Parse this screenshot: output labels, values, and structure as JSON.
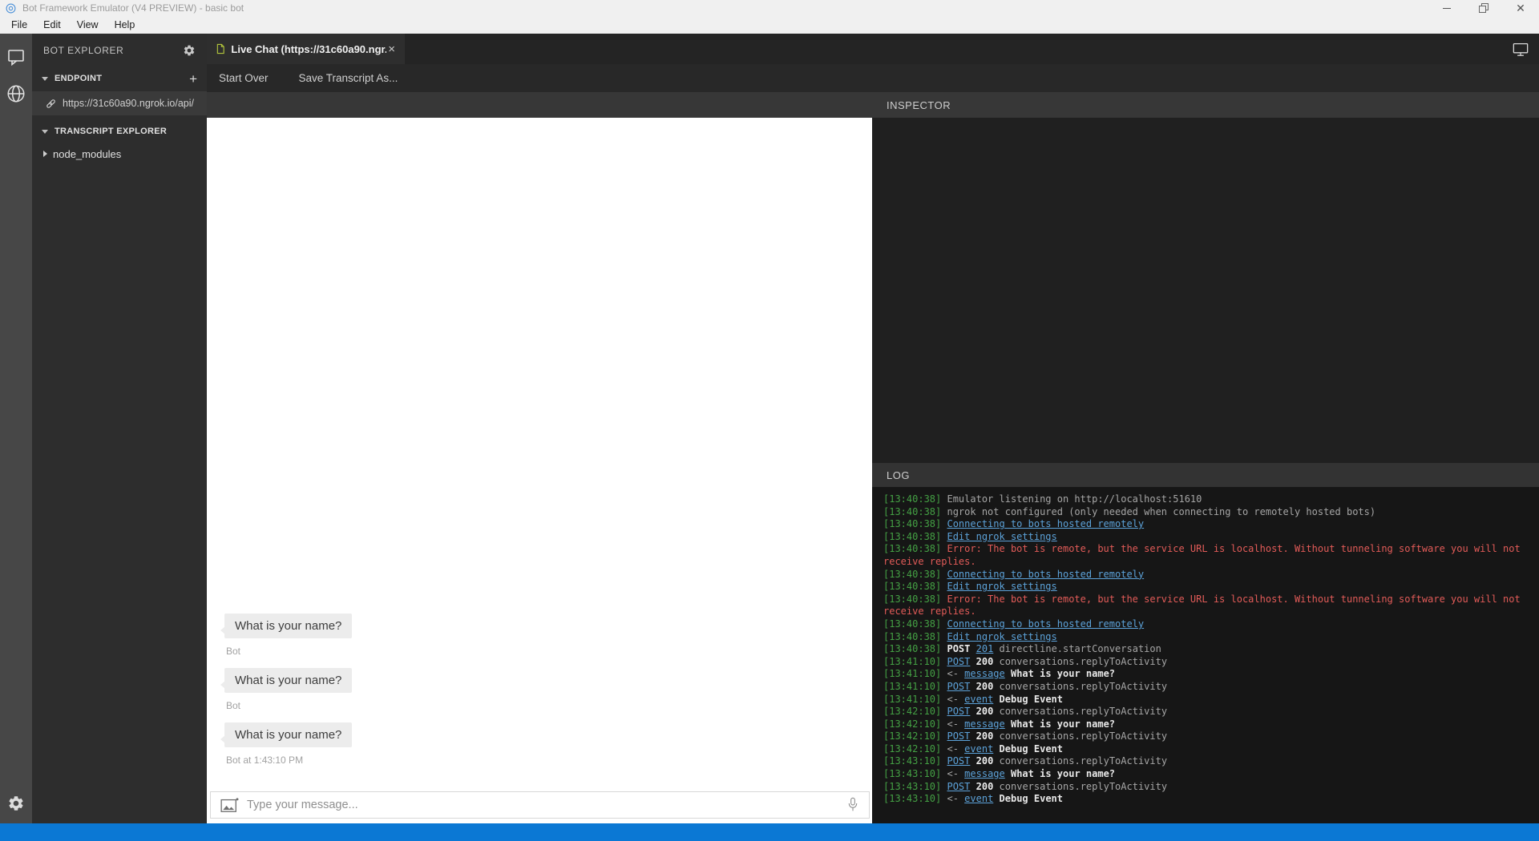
{
  "window": {
    "title": "Bot Framework Emulator (V4 PREVIEW) - basic bot"
  },
  "menu": {
    "items": [
      "File",
      "Edit",
      "View",
      "Help"
    ]
  },
  "rail": {
    "icons": [
      "chat-icon",
      "globe-icon",
      "settings-icon"
    ]
  },
  "explorer": {
    "title": "BOT EXPLORER",
    "endpoint_section": "ENDPOINT",
    "add_button": "+",
    "endpoint_url": "https://31c60a90.ngrok.io/api/",
    "transcript_section": "TRANSCRIPT EXPLORER",
    "transcript_items": [
      "node_modules"
    ]
  },
  "tab": {
    "label": "Live Chat (https://31c60a90.ngr...",
    "close": "×"
  },
  "toolbar": {
    "buttons": [
      "Start Over",
      "Save Transcript As..."
    ]
  },
  "chat": {
    "messages": [
      {
        "text": "What is your name?",
        "meta": "Bot"
      },
      {
        "text": "What is your name?",
        "meta": "Bot"
      },
      {
        "text": "What is your name?",
        "meta": "Bot at 1:43:10 PM"
      }
    ],
    "input_placeholder": "Type your message..."
  },
  "inspector": {
    "title": "INSPECTOR"
  },
  "log": {
    "title": "LOG",
    "entries": [
      {
        "ts": "13:40:38",
        "segments": [
          {
            "k": "text",
            "v": "Emulator listening on http://localhost:51610"
          }
        ]
      },
      {
        "ts": "13:40:38",
        "segments": [
          {
            "k": "text",
            "v": "ngrok not configured (only needed when connecting to remotely hosted bots)"
          }
        ]
      },
      {
        "ts": "13:40:38",
        "segments": [
          {
            "k": "link",
            "v": "Connecting to bots hosted remotely"
          }
        ]
      },
      {
        "ts": "13:40:38",
        "segments": [
          {
            "k": "link",
            "v": "Edit ngrok settings"
          }
        ]
      },
      {
        "ts": "13:40:38",
        "segments": [
          {
            "k": "error",
            "v": "Error: The bot is remote, but the service URL is localhost. Without tunneling software you will not receive replies."
          }
        ]
      },
      {
        "ts": "13:40:38",
        "segments": [
          {
            "k": "link",
            "v": "Connecting to bots hosted remotely"
          }
        ]
      },
      {
        "ts": "13:40:38",
        "segments": [
          {
            "k": "link",
            "v": "Edit ngrok settings"
          }
        ]
      },
      {
        "ts": "13:40:38",
        "segments": [
          {
            "k": "error",
            "v": "Error: The bot is remote, but the service URL is localhost. Without tunneling software you will not receive replies."
          }
        ]
      },
      {
        "ts": "13:40:38",
        "segments": [
          {
            "k": "link",
            "v": "Connecting to bots hosted remotely"
          }
        ]
      },
      {
        "ts": "13:40:38",
        "segments": [
          {
            "k": "link",
            "v": "Edit ngrok settings"
          }
        ]
      },
      {
        "ts": "13:40:38",
        "segments": [
          {
            "k": "bold",
            "v": "POST"
          },
          {
            "k": "link",
            "v": "201"
          },
          {
            "k": "text",
            "v": "directline.startConversation"
          }
        ]
      },
      {
        "ts": "13:41:10",
        "segments": [
          {
            "k": "link",
            "v": "POST"
          },
          {
            "k": "bold",
            "v": "200"
          },
          {
            "k": "text",
            "v": "conversations.replyToActivity"
          }
        ]
      },
      {
        "ts": "13:41:10",
        "segments": [
          {
            "k": "text",
            "v": "<-"
          },
          {
            "k": "link",
            "v": "message"
          },
          {
            "k": "msg",
            "v": "What is your name?"
          }
        ]
      },
      {
        "ts": "13:41:10",
        "segments": [
          {
            "k": "link",
            "v": "POST"
          },
          {
            "k": "bold",
            "v": "200"
          },
          {
            "k": "text",
            "v": "conversations.replyToActivity"
          }
        ]
      },
      {
        "ts": "13:41:10",
        "segments": [
          {
            "k": "text",
            "v": "<-"
          },
          {
            "k": "link",
            "v": "event"
          },
          {
            "k": "msg",
            "v": "Debug Event"
          }
        ]
      },
      {
        "ts": "13:42:10",
        "segments": [
          {
            "k": "link",
            "v": "POST"
          },
          {
            "k": "bold",
            "v": "200"
          },
          {
            "k": "text",
            "v": "conversations.replyToActivity"
          }
        ]
      },
      {
        "ts": "13:42:10",
        "segments": [
          {
            "k": "text",
            "v": "<-"
          },
          {
            "k": "link",
            "v": "message"
          },
          {
            "k": "msg",
            "v": "What is your name?"
          }
        ]
      },
      {
        "ts": "13:42:10",
        "segments": [
          {
            "k": "link",
            "v": "POST"
          },
          {
            "k": "bold",
            "v": "200"
          },
          {
            "k": "text",
            "v": "conversations.replyToActivity"
          }
        ]
      },
      {
        "ts": "13:42:10",
        "segments": [
          {
            "k": "text",
            "v": "<-"
          },
          {
            "k": "link",
            "v": "event"
          },
          {
            "k": "msg",
            "v": "Debug Event"
          }
        ]
      },
      {
        "ts": "13:43:10",
        "segments": [
          {
            "k": "link",
            "v": "POST"
          },
          {
            "k": "bold",
            "v": "200"
          },
          {
            "k": "text",
            "v": "conversations.replyToActivity"
          }
        ]
      },
      {
        "ts": "13:43:10",
        "segments": [
          {
            "k": "text",
            "v": "<-"
          },
          {
            "k": "link",
            "v": "message"
          },
          {
            "k": "msg",
            "v": "What is your name?"
          }
        ]
      },
      {
        "ts": "13:43:10",
        "segments": [
          {
            "k": "link",
            "v": "POST"
          },
          {
            "k": "bold",
            "v": "200"
          },
          {
            "k": "text",
            "v": "conversations.replyToActivity"
          }
        ]
      },
      {
        "ts": "13:43:10",
        "segments": [
          {
            "k": "text",
            "v": "<-"
          },
          {
            "k": "link",
            "v": "event"
          },
          {
            "k": "msg",
            "v": "Debug Event"
          }
        ]
      }
    ]
  },
  "colors": {
    "status_bar": "#0b78d4",
    "log_timestamp": "#44a044",
    "log_link": "#5ca2d9",
    "log_error": "#e25b58",
    "file_icon": "#b3c63c",
    "endpoint_selected_bg": "#3a3a3a"
  }
}
